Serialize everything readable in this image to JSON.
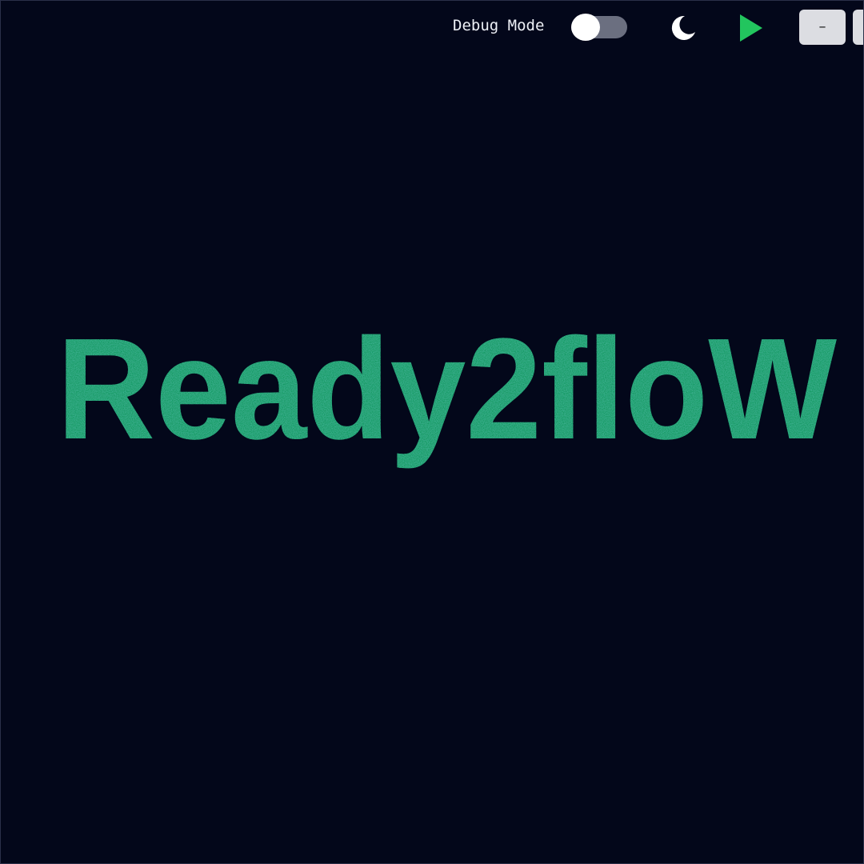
{
  "toolbar": {
    "debug_label": "Debug Mode",
    "debug_enabled": false,
    "minimize_label": "–"
  },
  "logo": {
    "text": "Ready2floW",
    "color": "#139a62"
  },
  "icons": {
    "theme": "moon-icon",
    "run": "play-icon"
  },
  "colors": {
    "background": "#03071a",
    "accent_green": "#22c55e",
    "button_bg": "#dcdde2"
  }
}
